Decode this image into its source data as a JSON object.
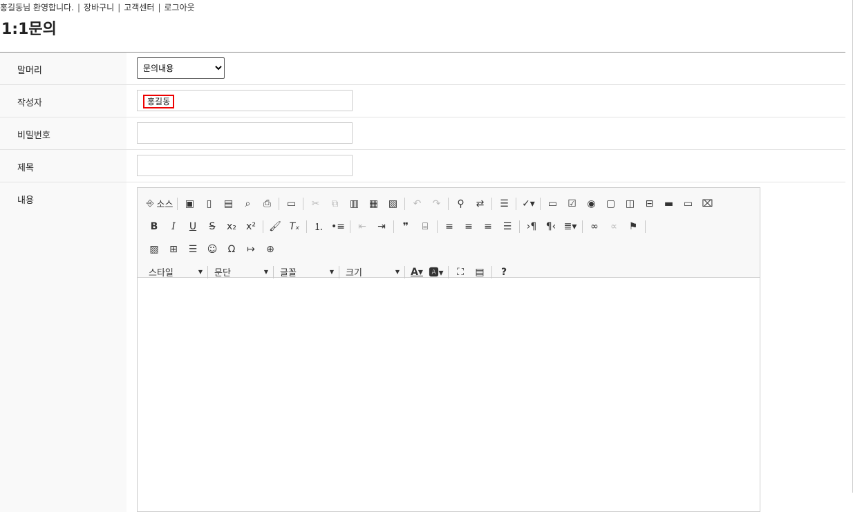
{
  "header": {
    "welcome": "홍길동님 환영합니다.",
    "links": [
      "장바구니",
      "고객센터",
      "로그아웃"
    ]
  },
  "page": {
    "title": "1:1문의"
  },
  "form": {
    "category": {
      "label": "말머리",
      "selected": "문의내용"
    },
    "author": {
      "label": "작성자",
      "value": "홍길동"
    },
    "password": {
      "label": "비밀번호",
      "value": ""
    },
    "subject": {
      "label": "제목",
      "value": ""
    },
    "content": {
      "label": "내용"
    }
  },
  "editor": {
    "source_label": "소스",
    "combos": {
      "style": "스타일",
      "format": "문단",
      "font": "글꼴",
      "size": "크기"
    }
  },
  "colors": {
    "highlight_border": "#e00000",
    "toolbar_bg": "#f8f8f8"
  }
}
